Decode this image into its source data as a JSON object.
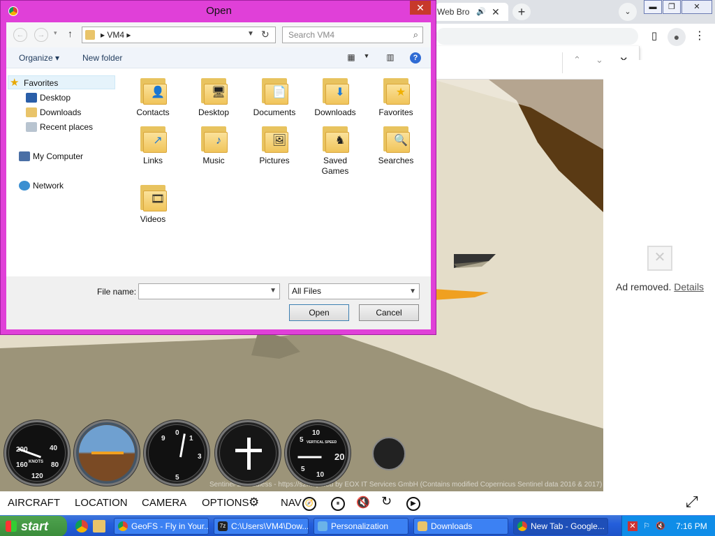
{
  "browser": {
    "tab_title": "Web Bro",
    "tab_speaker": "🔊",
    "tab_close": "✕",
    "new_tab": "+",
    "tab_search": "⌄",
    "win_min": "▬",
    "win_restore": "❐",
    "win_close": "✕"
  },
  "findbar": {
    "prev": "⌃",
    "next": "⌄",
    "close": "✕"
  },
  "ad": {
    "text": "Ad removed.",
    "details": "Details"
  },
  "game": {
    "credit": "Sentinel-2 cloudless - https://s2maps.eu by EOX IT Services GmbH (Contains modified Copernicus Sentinel data 2016 & 2017)",
    "menu": {
      "aircraft": "AIRCRAFT",
      "location": "LOCATION",
      "camera": "CAMERA",
      "options": "OPTIONS",
      "options_icon": "⚙",
      "nav": "NAV",
      "nav_icon": "🧭",
      "pause_icon": "⏸",
      "mute_icon": "🔇",
      "reset_icon": "↻",
      "play_icon": "▶",
      "fullscreen_icon": "⤢"
    },
    "gauges": {
      "airspeed": {
        "n1": "200",
        "n2": "40",
        "n3": "160",
        "n4": "80",
        "n5": "120",
        "unit": "KNOTS"
      },
      "altimeter": {
        "n1": "9",
        "n2": "0",
        "n3": "1",
        "n4": "3",
        "n5": "5"
      },
      "vsi": {
        "n1": "5",
        "n2": "10",
        "n3": "20",
        "n4": "10",
        "n5": "5",
        "label": "VERTICAL SPEED"
      }
    }
  },
  "taskbar": {
    "start": "start",
    "items": [
      {
        "label": "GeoFS - Fly in Your..."
      },
      {
        "label": "C:\\Users\\VM4\\Dow..."
      },
      {
        "label": "Personalization"
      },
      {
        "label": "Downloads"
      },
      {
        "label": "New Tab - Google..."
      }
    ],
    "clock": "7:16 PM"
  },
  "dialog": {
    "title": "Open",
    "close": "✕",
    "breadcrumb": "▸  VM4  ▸",
    "search_placeholder": "Search VM4",
    "organize": "Organize ▾",
    "new_folder": "New folder",
    "help": "?",
    "nav": {
      "favorites": "Favorites",
      "desktop": "Desktop",
      "downloads": "Downloads",
      "recent": "Recent places",
      "computer": "My Computer",
      "network": "Network"
    },
    "files": [
      {
        "name": "Contacts",
        "icon": "contacts-icon",
        "glyph": "👤"
      },
      {
        "name": "Desktop",
        "icon": "desktop-icon",
        "glyph": "🖥"
      },
      {
        "name": "Documents",
        "icon": "documents-icon",
        "glyph": "📄"
      },
      {
        "name": "Downloads",
        "icon": "downloads-icon",
        "glyph": "⬇"
      },
      {
        "name": "Favorites",
        "icon": "star-icon",
        "glyph": "★"
      },
      {
        "name": "Links",
        "icon": "links-icon",
        "glyph": "↗"
      },
      {
        "name": "Music",
        "icon": "music-icon",
        "glyph": "♪"
      },
      {
        "name": "Pictures",
        "icon": "pictures-icon",
        "glyph": "🖼"
      },
      {
        "name": "Saved Games",
        "icon": "chess-icon",
        "glyph": "♞"
      },
      {
        "name": "Searches",
        "icon": "magnifier-icon",
        "glyph": "🔍"
      },
      {
        "name": "Videos",
        "icon": "film-icon",
        "glyph": "🎞"
      }
    ],
    "file_name_label": "File name:",
    "file_name_value": "",
    "filter": "All Files",
    "open": "Open",
    "cancel": "Cancel"
  },
  "colors": {
    "dialog_border": "#e040d8",
    "taskbar": "#245edb",
    "start": "#3a8c3a"
  }
}
